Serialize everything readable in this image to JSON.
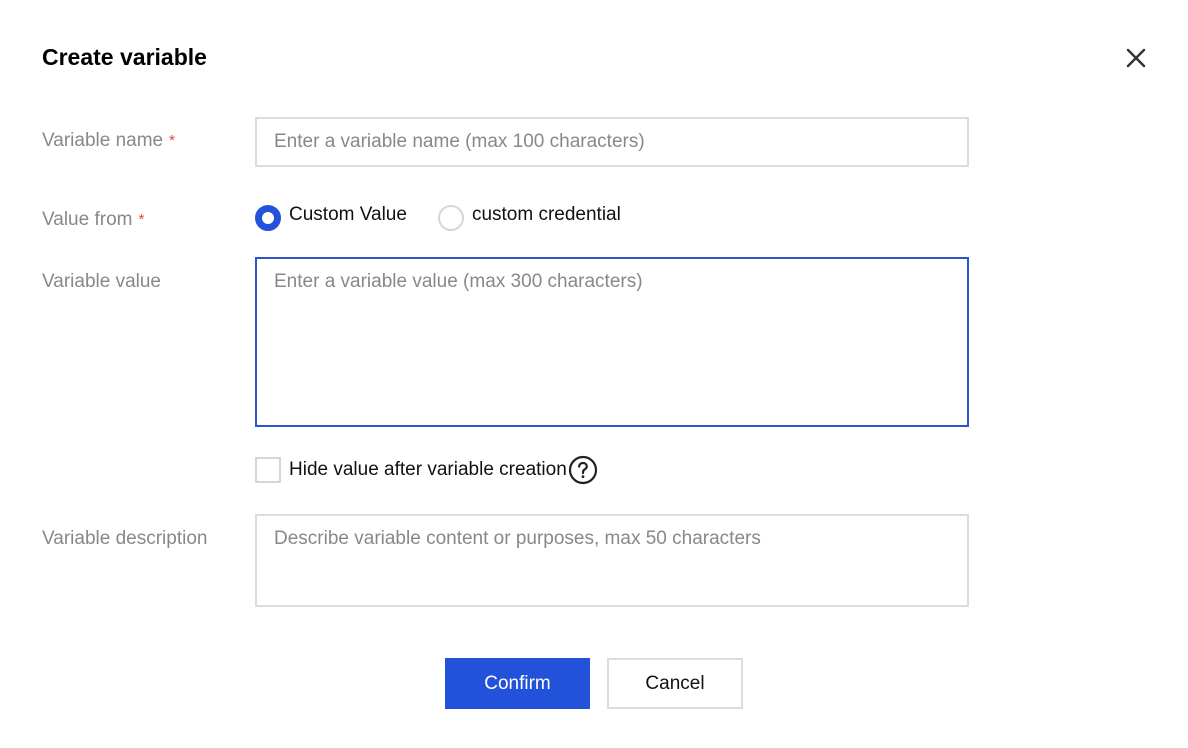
{
  "dialog": {
    "title": "Create variable",
    "close_icon": "close-icon"
  },
  "form": {
    "name": {
      "label": "Variable name",
      "required_mark": "*",
      "placeholder": "Enter a variable name (max 100 characters)",
      "value": ""
    },
    "value_from": {
      "label": "Value from",
      "required_mark": "*",
      "options": [
        {
          "label": "Custom Value",
          "selected": true
        },
        {
          "label": "custom credential",
          "selected": false
        }
      ]
    },
    "value": {
      "label": "Variable value",
      "placeholder": "Enter a variable value (max 300 characters)",
      "value": ""
    },
    "hide_value": {
      "label": "Hide value after variable creation",
      "checked": false,
      "help_icon": "question-circle-icon"
    },
    "description": {
      "label": "Variable description",
      "placeholder": "Describe variable content or purposes, max 50 characters",
      "value": ""
    }
  },
  "actions": {
    "confirm_label": "Confirm",
    "cancel_label": "Cancel"
  },
  "colors": {
    "primary": "#2152d9",
    "required": "#e54545",
    "label": "#888888",
    "border": "#dcdcdc",
    "focus_border": "#2b55cc"
  }
}
